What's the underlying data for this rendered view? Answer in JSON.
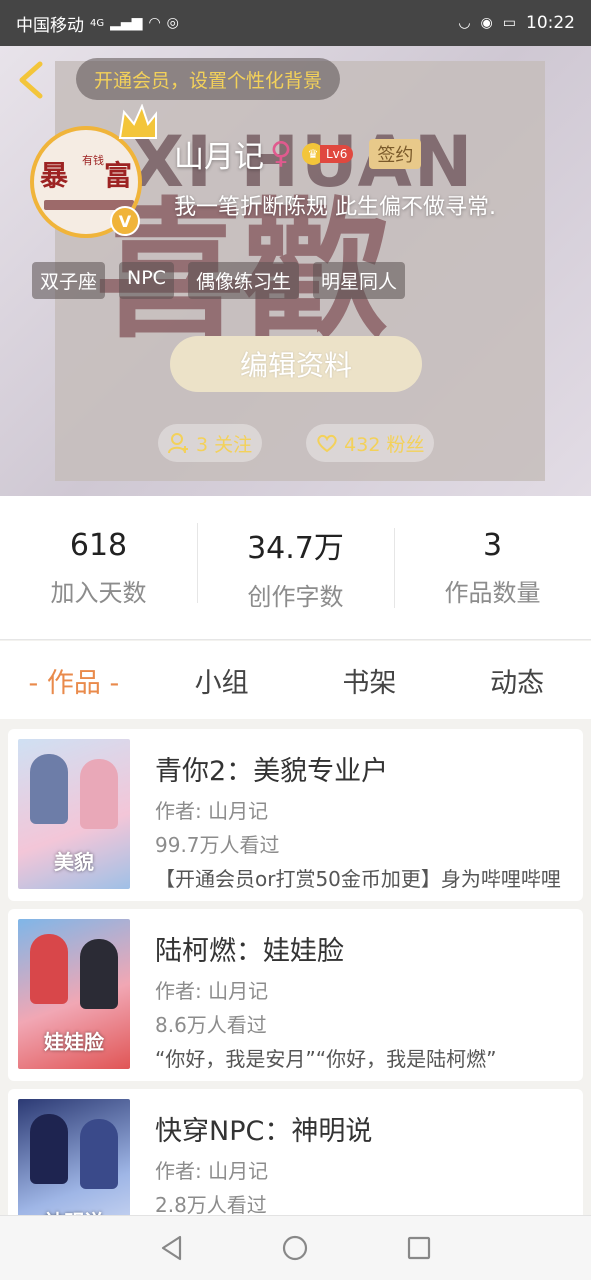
{
  "status_bar": {
    "carrier": "中国移动",
    "network": "4G",
    "time": "10:22"
  },
  "header": {
    "vip_banner": "开通会员，设置个性化背景",
    "poster_text": "XI HUAN",
    "poster_big": "喜歡",
    "username": "山月记",
    "gender_symbol": "♀",
    "level": "Lv6",
    "signed_label": "签约",
    "verified_mark": "V",
    "signature": "我一笔折断陈规 此生偏不做寻常.",
    "avatar_text": [
      "暴",
      "有钱",
      "富"
    ],
    "tags": [
      "双子座",
      "NPC",
      "偶像练习生",
      "明星同人"
    ],
    "edit_button": "编辑资料",
    "following": "3 关注",
    "followers": "432 粉丝"
  },
  "stats": [
    {
      "value": "618",
      "label": "加入天数"
    },
    {
      "value": "34.7万",
      "label": "创作字数"
    },
    {
      "value": "3",
      "label": "作品数量"
    }
  ],
  "tabs": [
    {
      "label": "- 作品 -",
      "active": true
    },
    {
      "label": "小组",
      "active": false
    },
    {
      "label": "书架",
      "active": false
    },
    {
      "label": "动态",
      "active": false
    }
  ],
  "books": [
    {
      "title": "青你2：美貌专业户",
      "author": "作者: 山月记",
      "views": "99.7万人看过",
      "desc": "【开通会员or打赏50金币加更】身为哔哩哔哩",
      "cover_text": "美貌",
      "cover_colors": [
        "#cfe0f3",
        "#f3c6d8",
        "#9fc0e6"
      ]
    },
    {
      "title": "陆柯燃：娃娃脸",
      "author": "作者: 山月记",
      "views": "8.6万人看过",
      "desc": "“你好，我是安月”“你好，我是陆柯燃”",
      "cover_text": "娃娃脸",
      "cover_colors": [
        "#7fb6e8",
        "#e05555",
        "#f1a7b4"
      ]
    },
    {
      "title": "快穿NPC：神明说",
      "author": "作者: 山月记",
      "views": "2.8万人看过",
      "desc": "",
      "cover_text": "神明说",
      "cover_colors": [
        "#2c3a74",
        "#9fb6e6",
        "#d8e0f5"
      ]
    }
  ],
  "colors": {
    "accent": "#e98a4b",
    "gold": "#f3d15a",
    "status_bar": "#454545"
  }
}
